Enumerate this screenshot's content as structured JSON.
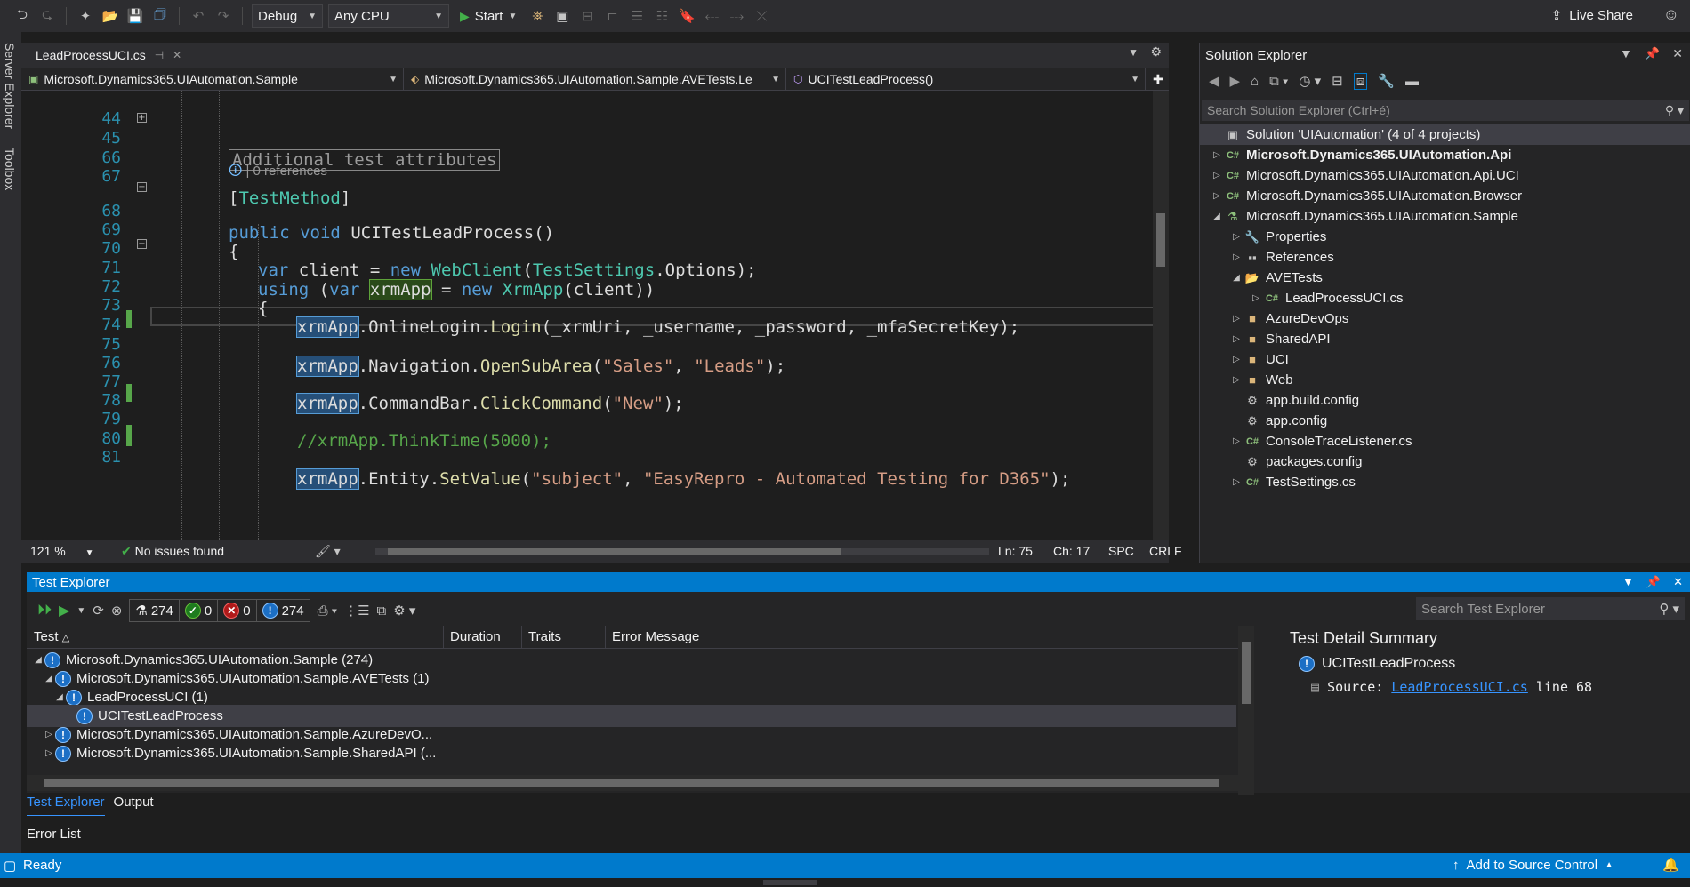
{
  "toolbar": {
    "configuration": "Debug",
    "platform": "Any CPU",
    "start_label": "Start",
    "live_share": "Live Share"
  },
  "side_tabs": [
    "Server Explorer",
    "Toolbox"
  ],
  "editor": {
    "tab_title": "LeadProcessUCI.cs",
    "nav": {
      "project": "Microsoft.Dynamics365.UIAutomation.Sample",
      "class": "Microsoft.Dynamics365.UIAutomation.Sample.AVETests.Le",
      "member": "UCITestLeadProcess()"
    },
    "lines": [
      {
        "n": "44"
      },
      {
        "n": "45",
        "collapsed": "Additional test attributes"
      },
      {
        "n": "66"
      },
      {
        "n": "67",
        "attr_open": "[",
        "attr": "TestMethod",
        "attr_close": "]"
      },
      {
        "n": "",
        "codelens": "| 0 references"
      },
      {
        "n": "68",
        "kw1": "public",
        "kw2": "void",
        "name": "UCITestLeadProcess",
        "rest": "()"
      },
      {
        "n": "69",
        "text": "{"
      },
      {
        "n": "70",
        "kw": "var",
        "a": " client = ",
        "kw2": "new",
        "ty": "WebClient",
        "b": "(",
        "ty2": "TestSettings",
        "c": ".Options);"
      },
      {
        "n": "71",
        "kw": "using",
        "a": " (",
        "kw2": "var",
        "var": "xrmApp",
        "b": " = ",
        "kw3": "new",
        "ty": "XrmApp",
        "c": "(client))"
      },
      {
        "n": "72",
        "text": "{"
      },
      {
        "n": "73",
        "var": "xrmApp",
        "a": ".OnlineLogin.",
        "mt": "Login",
        "b": "(_xrmUri, _username, _password, _mfaSecretKey);"
      },
      {
        "n": "74"
      },
      {
        "n": "75",
        "var": "xrmApp",
        "a": ".Navigation.",
        "mt": "OpenSubArea",
        "b": "(",
        "s1": "\"Sales\"",
        "c": ", ",
        "s2": "\"Leads\"",
        "d": ");"
      },
      {
        "n": "76"
      },
      {
        "n": "77",
        "var": "xrmApp",
        "a": ".CommandBar.",
        "mt": "ClickCommand",
        "b": "(",
        "s1": "\"New\"",
        "c": ");"
      },
      {
        "n": "78"
      },
      {
        "n": "79",
        "comment": "//xrmApp.ThinkTime(5000);"
      },
      {
        "n": "80"
      },
      {
        "n": "81",
        "var": "xrmApp",
        "a": ".Entity.",
        "mt": "SetValue",
        "b": "(",
        "s1": "\"subject\"",
        "c": ", ",
        "s2": "\"EasyRepro - Automated Testing for D365\"",
        "d": ");"
      }
    ],
    "status": {
      "zoom": "121 %",
      "issues": "No issues found",
      "line": "Ln: 75",
      "col": "Ch: 17",
      "whitespace": "SPC",
      "eol": "CRLF"
    }
  },
  "solution_explorer": {
    "title": "Solution Explorer",
    "search_placeholder": "Search Solution Explorer (Ctrl+é)",
    "items": [
      {
        "label": "Solution 'UIAutomation' (4 of 4 projects)",
        "icon": "solution-icon",
        "glyph": "▣",
        "color": "#c5c5c5",
        "indent": 0,
        "toggle": "",
        "selected": true
      },
      {
        "label": "Microsoft.Dynamics365.UIAutomation.Api",
        "icon": "csharp-project-icon",
        "glyph": "C#",
        "color": "#8ec07c",
        "indent": 0,
        "toggle": "▷",
        "bold": true
      },
      {
        "label": "Microsoft.Dynamics365.UIAutomation.Api.UCI",
        "icon": "csharp-project-icon",
        "glyph": "C#",
        "color": "#8ec07c",
        "indent": 0,
        "toggle": "▷"
      },
      {
        "label": "Microsoft.Dynamics365.UIAutomation.Browser",
        "icon": "csharp-project-icon",
        "glyph": "C#",
        "color": "#8ec07c",
        "indent": 0,
        "toggle": "▷"
      },
      {
        "label": "Microsoft.Dynamics365.UIAutomation.Sample",
        "icon": "test-project-icon",
        "glyph": "⚗",
        "color": "#8ec07c",
        "indent": 0,
        "toggle": "◢"
      },
      {
        "label": "Properties",
        "icon": "wrench-icon",
        "glyph": "🔧",
        "color": "#c5c5c5",
        "indent": 1,
        "toggle": "▷"
      },
      {
        "label": "References",
        "icon": "references-icon",
        "glyph": "▪▪",
        "color": "#c5c5c5",
        "indent": 1,
        "toggle": "▷"
      },
      {
        "label": "AVETests",
        "icon": "folder-open-icon",
        "glyph": "📂",
        "color": "#dcb67a",
        "indent": 1,
        "toggle": "◢"
      },
      {
        "label": "LeadProcessUCI.cs",
        "icon": "csharp-file-icon",
        "glyph": "C#",
        "color": "#8ec07c",
        "indent": 2,
        "toggle": "▷"
      },
      {
        "label": "AzureDevOps",
        "icon": "folder-icon",
        "glyph": "■",
        "color": "#dcb67a",
        "indent": 1,
        "toggle": "▷"
      },
      {
        "label": "SharedAPI",
        "icon": "folder-icon",
        "glyph": "■",
        "color": "#dcb67a",
        "indent": 1,
        "toggle": "▷"
      },
      {
        "label": "UCI",
        "icon": "folder-icon",
        "glyph": "■",
        "color": "#dcb67a",
        "indent": 1,
        "toggle": "▷"
      },
      {
        "label": "Web",
        "icon": "folder-icon",
        "glyph": "■",
        "color": "#dcb67a",
        "indent": 1,
        "toggle": "▷"
      },
      {
        "label": "app.build.config",
        "icon": "config-file-icon",
        "glyph": "⚙",
        "color": "#c5c5c5",
        "indent": 1,
        "toggle": ""
      },
      {
        "label": "app.config",
        "icon": "config-file-icon",
        "glyph": "⚙",
        "color": "#c5c5c5",
        "indent": 1,
        "toggle": ""
      },
      {
        "label": "ConsoleTraceListener.cs",
        "icon": "csharp-file-icon",
        "glyph": "C#",
        "color": "#8ec07c",
        "indent": 1,
        "toggle": "▷"
      },
      {
        "label": "packages.config",
        "icon": "config-file-icon",
        "glyph": "⚙",
        "color": "#c5c5c5",
        "indent": 1,
        "toggle": ""
      },
      {
        "label": "TestSettings.cs",
        "icon": "csharp-file-icon",
        "glyph": "C#",
        "color": "#8ec07c",
        "indent": 1,
        "toggle": "▷"
      }
    ]
  },
  "test_explorer": {
    "title": "Test Explorer",
    "counts": {
      "total": "274",
      "passed": "0",
      "failed": "0",
      "not_run": "274"
    },
    "search_placeholder": "Search Test Explorer",
    "columns": [
      "Test",
      "Duration",
      "Traits",
      "Error Message"
    ],
    "rows": [
      {
        "label": "Microsoft.Dynamics365.UIAutomation.Sample (274)",
        "indent": 0,
        "toggle": "◢"
      },
      {
        "label": "Microsoft.Dynamics365.UIAutomation.Sample.AVETests (1)",
        "indent": 1,
        "toggle": "◢"
      },
      {
        "label": "LeadProcessUCI (1)",
        "indent": 2,
        "toggle": "◢"
      },
      {
        "label": "UCITestLeadProcess",
        "indent": 3,
        "toggle": "",
        "selected": true
      },
      {
        "label": "Microsoft.Dynamics365.UIAutomation.Sample.AzureDevO...",
        "indent": 1,
        "toggle": "▷"
      },
      {
        "label": "Microsoft.Dynamics365.UIAutomation.Sample.SharedAPI (...",
        "indent": 1,
        "toggle": "▷"
      }
    ],
    "detail": {
      "title": "Test Detail Summary",
      "test_name": "UCITestLeadProcess",
      "source_label": "Source:",
      "source_file": "LeadProcessUCI.cs",
      "source_line": "line 68"
    },
    "tabs": [
      "Test Explorer",
      "Output"
    ],
    "error_list": "Error List"
  },
  "status_bar": {
    "state": "Ready",
    "source_control": "Add to Source Control"
  }
}
